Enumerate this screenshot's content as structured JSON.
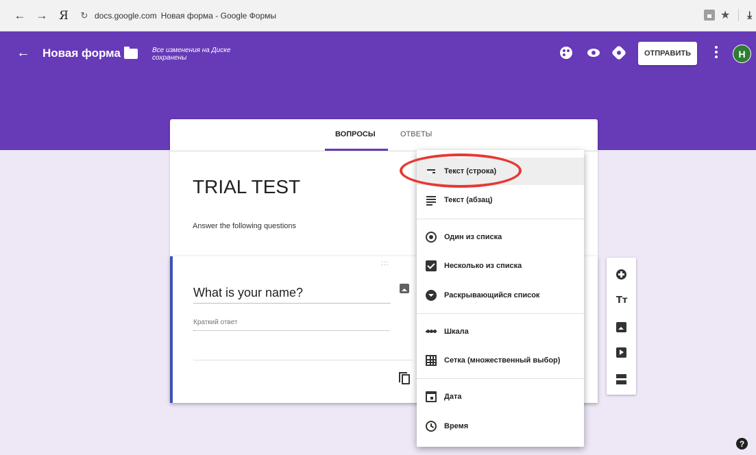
{
  "browser": {
    "back_icon": "←",
    "forward_icon": "→",
    "yandex_icon": "Я",
    "reload_icon": "↻",
    "url": "docs.google.com",
    "page_title": "Новая форма - Google Формы",
    "star_icon": "★",
    "download_icon": "⤓"
  },
  "header": {
    "back_icon": "←",
    "title": "Новая форма",
    "status": "Все изменения на Диске сохранены",
    "send_label": "ОТПРАВИТЬ",
    "avatar_letter": "Н",
    "color": "#673ab7"
  },
  "tabs": {
    "questions": "ВОПРОСЫ",
    "answers": "ОТВЕТЫ"
  },
  "form": {
    "title": "TRIAL TEST",
    "description": "Answer the following questions"
  },
  "question": {
    "drag_handle": ":::",
    "title": "What is your name?",
    "short_answer": "Краткий ответ"
  },
  "toolbar": {
    "text_icon": "Tт"
  },
  "menu": {
    "items": [
      {
        "label": "Текст (строка)",
        "icon": "short-text-icon"
      },
      {
        "label": "Текст (абзац)",
        "icon": "paragraph-icon"
      },
      {
        "label": "Один из списка",
        "icon": "radio-icon"
      },
      {
        "label": "Несколько из списка",
        "icon": "checkbox-icon"
      },
      {
        "label": "Раскрывающийся список",
        "icon": "dropdown-icon"
      },
      {
        "label": "Шкала",
        "icon": "scale-icon"
      },
      {
        "label": "Сетка (множественный выбор)",
        "icon": "grid-icon"
      },
      {
        "label": "Дата",
        "icon": "calendar-icon"
      },
      {
        "label": "Время",
        "icon": "clock-icon"
      }
    ]
  },
  "help_icon": "?",
  "highlight_color": "#e53935"
}
